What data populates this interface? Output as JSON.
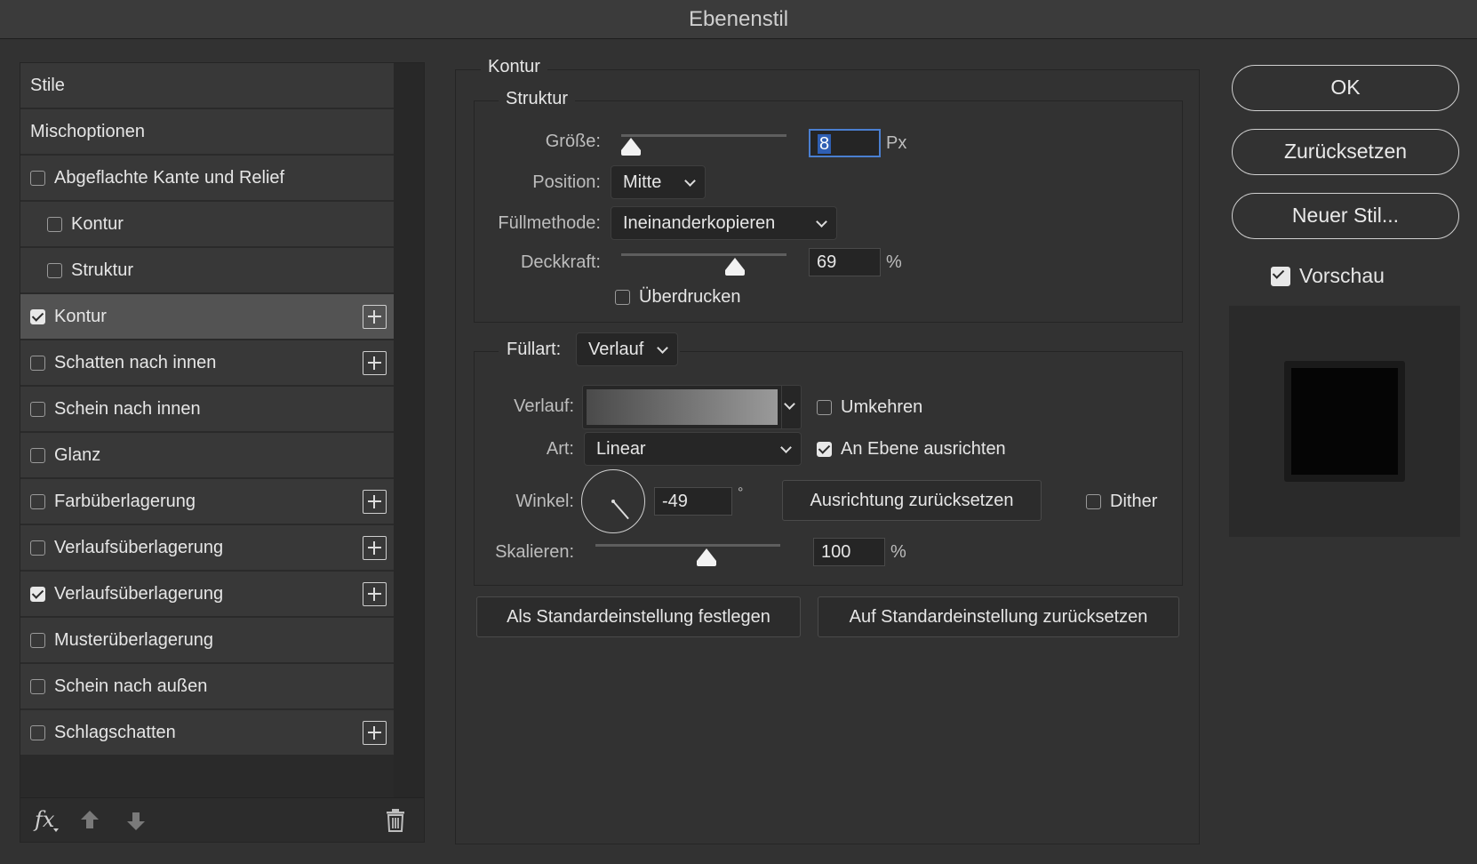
{
  "window": {
    "title": "Ebenenstil"
  },
  "sidebar": {
    "items": [
      {
        "label": "Stile",
        "checkbox": false,
        "checked": false,
        "indent": 0,
        "plus": false,
        "active": false
      },
      {
        "label": "Mischoptionen",
        "checkbox": false,
        "checked": false,
        "indent": 0,
        "plus": false,
        "active": false
      },
      {
        "label": "Abgeflachte Kante und Relief",
        "checkbox": true,
        "checked": false,
        "indent": 0,
        "plus": false,
        "active": false
      },
      {
        "label": "Kontur",
        "checkbox": true,
        "checked": false,
        "indent": 1,
        "plus": false,
        "active": false
      },
      {
        "label": "Struktur",
        "checkbox": true,
        "checked": false,
        "indent": 1,
        "plus": false,
        "active": false
      },
      {
        "label": "Kontur",
        "checkbox": true,
        "checked": true,
        "indent": 0,
        "plus": true,
        "active": true
      },
      {
        "label": "Schatten nach innen",
        "checkbox": true,
        "checked": false,
        "indent": 0,
        "plus": true,
        "active": false
      },
      {
        "label": "Schein nach innen",
        "checkbox": true,
        "checked": false,
        "indent": 0,
        "plus": false,
        "active": false
      },
      {
        "label": "Glanz",
        "checkbox": true,
        "checked": false,
        "indent": 0,
        "plus": false,
        "active": false
      },
      {
        "label": "Farbüberlagerung",
        "checkbox": true,
        "checked": false,
        "indent": 0,
        "plus": true,
        "active": false
      },
      {
        "label": "Verlaufsüberlagerung",
        "checkbox": true,
        "checked": false,
        "indent": 0,
        "plus": true,
        "active": false
      },
      {
        "label": "Verlaufsüberlagerung",
        "checkbox": true,
        "checked": true,
        "indent": 0,
        "plus": true,
        "active": false
      },
      {
        "label": "Musterüberlagerung",
        "checkbox": true,
        "checked": false,
        "indent": 0,
        "plus": false,
        "active": false
      },
      {
        "label": "Schein nach außen",
        "checkbox": true,
        "checked": false,
        "indent": 0,
        "plus": false,
        "active": false
      },
      {
        "label": "Schlagschatten",
        "checkbox": true,
        "checked": false,
        "indent": 0,
        "plus": true,
        "active": false
      }
    ],
    "footer": {
      "fx_label": "fx",
      "icons": [
        "fx-icon",
        "arrow-up-icon",
        "arrow-down-icon",
        "trash-icon"
      ]
    }
  },
  "main": {
    "section_title": "Kontur",
    "structure": {
      "legend": "Struktur",
      "size_label": "Größe:",
      "size_value": "8",
      "size_unit": "Px",
      "size_slider_fraction": 0.06,
      "position_label": "Position:",
      "position_value": "Mitte",
      "blend_label": "Füllmethode:",
      "blend_value": "Ineinanderkopieren",
      "opacity_label": "Deckkraft:",
      "opacity_value": "69",
      "opacity_unit": "%",
      "opacity_slider_fraction": 0.69,
      "overprint_label": "Überdrucken",
      "overprint_checked": false
    },
    "fill": {
      "fill_type_label": "Füllart:",
      "fill_type_value": "Verlauf",
      "gradient_label": "Verlauf:",
      "reverse_label": "Umkehren",
      "reverse_checked": false,
      "style_label": "Art:",
      "style_value": "Linear",
      "align_label": "An Ebene ausrichten",
      "align_checked": true,
      "angle_label": "Winkel:",
      "angle_value": "-49",
      "angle_unit": "°",
      "reset_alignment_label": "Ausrichtung zurücksetzen",
      "dither_label": "Dither",
      "dither_checked": false,
      "scale_label": "Skalieren:",
      "scale_value": "100",
      "scale_unit": "%",
      "scale_slider_fraction": 0.6
    },
    "make_default_label": "Als Standardeinstellung festlegen",
    "reset_default_label": "Auf Standardeinstellung zurücksetzen"
  },
  "right": {
    "ok_label": "OK",
    "reset_label": "Zurücksetzen",
    "new_style_label": "Neuer Stil...",
    "preview_label": "Vorschau",
    "preview_checked": true
  },
  "colors": {
    "background": "#323232",
    "accent": "#4a7fd0",
    "preview_swatch": "#050505"
  }
}
